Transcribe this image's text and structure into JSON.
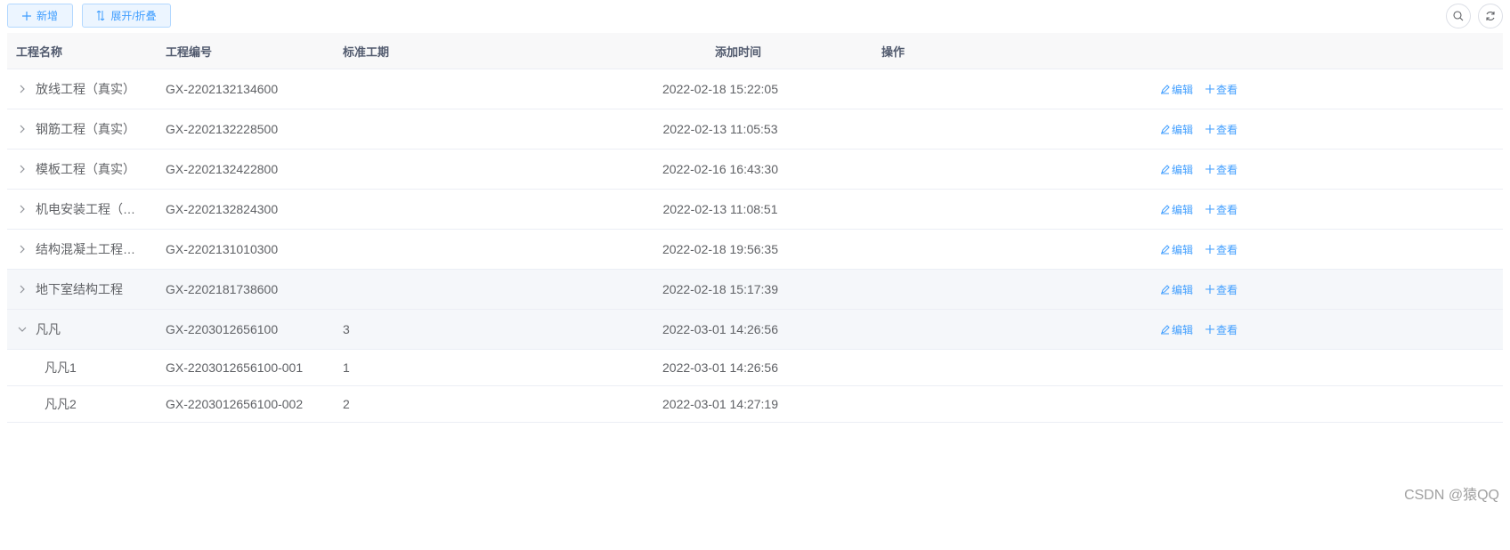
{
  "toolbar": {
    "add_label": "新增",
    "toggle_label": "展开/折叠"
  },
  "table": {
    "columns": [
      "工程名称",
      "工程编号",
      "标准工期",
      "添加时间",
      "操作"
    ],
    "rows": [
      {
        "name": "放线工程（真实）",
        "code": "GX-2202132134600",
        "period": "",
        "time": "2022-02-18 15:22:05",
        "expanded": false
      },
      {
        "name": "钢筋工程（真实）",
        "code": "GX-2202132228500",
        "period": "",
        "time": "2022-02-13 11:05:53",
        "expanded": false
      },
      {
        "name": "模板工程（真实）",
        "code": "GX-2202132422800",
        "period": "",
        "time": "2022-02-16 16:43:30",
        "expanded": false
      },
      {
        "name": "机电安装工程（…",
        "code": "GX-2202132824300",
        "period": "",
        "time": "2022-02-13 11:08:51",
        "expanded": false
      },
      {
        "name": "结构混凝土工程…",
        "code": "GX-2202131010300",
        "period": "",
        "time": "2022-02-18 19:56:35",
        "expanded": false
      },
      {
        "name": "地下室结构工程",
        "code": "GX-2202181738600",
        "period": "",
        "time": "2022-02-18 15:17:39",
        "expanded": false
      },
      {
        "name": "凡凡",
        "code": "GX-2203012656100",
        "period": "3",
        "time": "2022-03-01 14:26:56",
        "expanded": true
      }
    ],
    "children": [
      {
        "name": "凡凡1",
        "code": "GX-2203012656100-001",
        "period": "1",
        "time": "2022-03-01 14:26:56"
      },
      {
        "name": "凡凡2",
        "code": "GX-2203012656100-002",
        "period": "2",
        "time": "2022-03-01 14:27:19"
      }
    ],
    "edit_label": "编辑",
    "view_label": "查看"
  },
  "watermark": "CSDN @猿QQ",
  "colors": {
    "accent": "#409eff",
    "header_bg": "#f8f8f9",
    "border": "#ebeef5"
  }
}
